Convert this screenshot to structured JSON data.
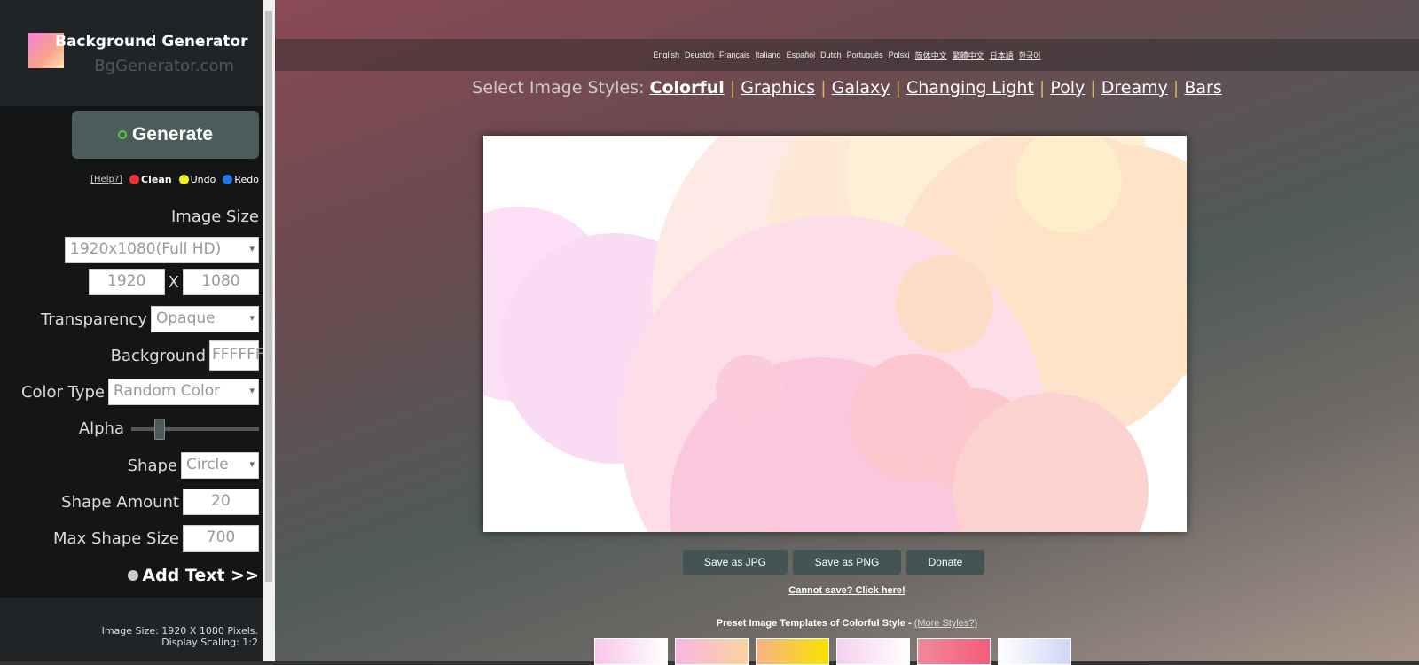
{
  "header": {
    "title": "Background Generator",
    "subtitle": "BgGenerator.com"
  },
  "sidebar": {
    "generate_label": "Generate",
    "help_label": "[Help?]",
    "clean_label": "Clean",
    "undo_label": "Undo",
    "redo_label": "Redo",
    "image_size_label": "Image Size",
    "image_size_value": "1920x1080(Full HD)",
    "width_value": "1920",
    "x_label": "X",
    "height_value": "1080",
    "transparency_label": "Transparency",
    "transparency_value": "Opaque",
    "background_label": "Background",
    "background_value": "FFFFFF",
    "color_type_label": "Color Type",
    "color_type_value": "Random Color",
    "alpha_label": "Alpha",
    "alpha_value": 0.2,
    "shape_label": "Shape",
    "shape_value": "Circle",
    "shape_amount_label": "Shape Amount",
    "shape_amount_value": "20",
    "max_shape_size_label": "Max Shape Size",
    "max_shape_size_value": "700",
    "add_text_label": "Add Text >>",
    "footer_size": "Image Size: 1920 X 1080 Pixels.",
    "footer_scaling": "Display Scaling: 1:2"
  },
  "languages": [
    "English",
    "Deustch",
    "Français",
    "Italiano",
    "Español",
    "Dutch",
    "Português",
    "Polski",
    "简体中文",
    "繁體中文",
    "日本語",
    "한국어"
  ],
  "styles": {
    "label": "Select Image Styles:",
    "items": [
      "Colorful",
      "Graphics",
      "Galaxy",
      "Changing Light",
      "Poly",
      "Dreamy",
      "Bars"
    ]
  },
  "buttons": {
    "save_jpg": "Save as JPG",
    "save_png": "Save as PNG",
    "donate": "Donate"
  },
  "cannot_save": "Cannot save? Click here!",
  "preset": {
    "label": "Preset Image Templates of Colorful Style -",
    "more": "(More Styles?)"
  }
}
